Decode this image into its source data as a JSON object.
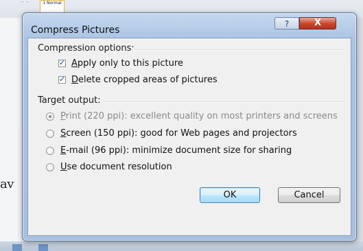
{
  "dialog": {
    "title": "Compress Pictures",
    "help_glyph": "?",
    "close_glyph": "X"
  },
  "compression": {
    "heading": "Compression options:",
    "options": [
      {
        "mnemonic": "A",
        "rest": "pply only to this picture",
        "checked": true
      },
      {
        "mnemonic": "D",
        "rest": "elete cropped areas of pictures",
        "checked": true
      }
    ]
  },
  "target": {
    "heading": "Target output:",
    "options": [
      {
        "mnemonic": "P",
        "rest": "rint (220 ppi): excellent quality on most printers and screens",
        "selected": true,
        "enabled": false
      },
      {
        "mnemonic": "S",
        "rest": "creen (150 ppi): good for Web pages and projectors",
        "selected": false,
        "enabled": true
      },
      {
        "mnemonic": "E",
        "rest": "-mail (96 ppi): minimize document size for sharing",
        "selected": false,
        "enabled": true
      },
      {
        "mnemonic": "U",
        "rest": "se document resolution",
        "selected": false,
        "enabled": true
      }
    ]
  },
  "buttons": {
    "ok": "OK",
    "cancel": "Cancel"
  },
  "background": {
    "style_thumb": "1 Normal",
    "dots": "⁻ ⁻",
    "doc_text": "av"
  }
}
